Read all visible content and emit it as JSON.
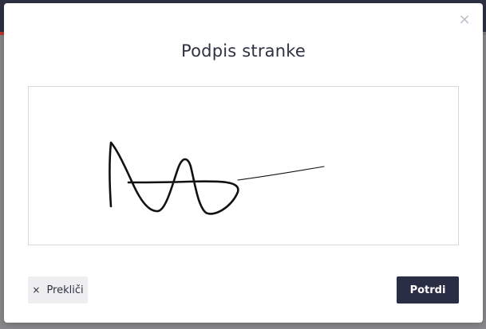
{
  "dialog": {
    "title": "Podpis stranke",
    "close_icon": "close-icon",
    "close_glyph": "×"
  },
  "signature_pad": {
    "has_signature": true,
    "ink_color": "#111111"
  },
  "actions": {
    "cancel_label": "Prekliči",
    "cancel_icon_glyph": "×",
    "confirm_label": "Potrdi"
  },
  "colors": {
    "primary": "#2a2e45",
    "title": "#2d3142",
    "secondary_button_bg": "#eeeef0",
    "backdrop": "#7d7d7f"
  }
}
